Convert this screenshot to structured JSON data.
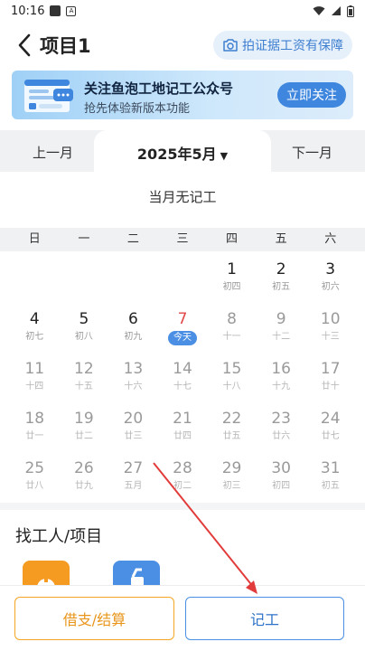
{
  "status_bar": {
    "time": "10:16"
  },
  "header": {
    "title": "项目1",
    "proof_label": "拍证据工资有保障"
  },
  "banner": {
    "title": "关注鱼泡工地记工公众号",
    "subtitle": "抢先体验新版本功能",
    "follow_label": "立即关注"
  },
  "month_nav": {
    "prev_label": "上一月",
    "current": "2025年5月",
    "next_label": "下一月"
  },
  "no_record_text": "当月无记工",
  "weekdays": [
    "日",
    "一",
    "二",
    "三",
    "四",
    "五",
    "六"
  ],
  "calendar": {
    "leading_blanks": 4,
    "days": [
      {
        "num": "1",
        "sub": "初四",
        "state": "past"
      },
      {
        "num": "2",
        "sub": "初五",
        "state": "past"
      },
      {
        "num": "3",
        "sub": "初六",
        "state": "past"
      },
      {
        "num": "4",
        "sub": "初七",
        "state": "past"
      },
      {
        "num": "5",
        "sub": "初八",
        "state": "past"
      },
      {
        "num": "6",
        "sub": "初九",
        "state": "past"
      },
      {
        "num": "7",
        "sub": "今天",
        "state": "today"
      },
      {
        "num": "8",
        "sub": "十一",
        "state": "future"
      },
      {
        "num": "9",
        "sub": "十二",
        "state": "future"
      },
      {
        "num": "10",
        "sub": "十三",
        "state": "future"
      },
      {
        "num": "11",
        "sub": "十四",
        "state": "future"
      },
      {
        "num": "12",
        "sub": "十五",
        "state": "future"
      },
      {
        "num": "13",
        "sub": "十六",
        "state": "future"
      },
      {
        "num": "14",
        "sub": "十七",
        "state": "future"
      },
      {
        "num": "15",
        "sub": "十八",
        "state": "future"
      },
      {
        "num": "16",
        "sub": "十九",
        "state": "future"
      },
      {
        "num": "17",
        "sub": "廿十",
        "state": "future"
      },
      {
        "num": "18",
        "sub": "廿一",
        "state": "future"
      },
      {
        "num": "19",
        "sub": "廿二",
        "state": "future"
      },
      {
        "num": "20",
        "sub": "廿三",
        "state": "future"
      },
      {
        "num": "21",
        "sub": "廿四",
        "state": "future"
      },
      {
        "num": "22",
        "sub": "廿五",
        "state": "future"
      },
      {
        "num": "23",
        "sub": "廿六",
        "state": "future"
      },
      {
        "num": "24",
        "sub": "廿七",
        "state": "future"
      },
      {
        "num": "25",
        "sub": "廿八",
        "state": "future"
      },
      {
        "num": "26",
        "sub": "廿九",
        "state": "future"
      },
      {
        "num": "27",
        "sub": "五月",
        "state": "future"
      },
      {
        "num": "28",
        "sub": "初二",
        "state": "future"
      },
      {
        "num": "29",
        "sub": "初三",
        "state": "future"
      },
      {
        "num": "30",
        "sub": "初四",
        "state": "future"
      },
      {
        "num": "31",
        "sub": "初五",
        "state": "future"
      }
    ]
  },
  "find_section": {
    "title": "找工人/项目"
  },
  "bottom_bar": {
    "borrow_label": "借支/结算",
    "record_label": "记工"
  },
  "colors": {
    "accent_blue": "#4a8fe4",
    "accent_orange": "#f5a623",
    "today_red": "#e04848",
    "annotation_arrow": "#e23b3b"
  },
  "icons": {
    "back": "chevron-left-icon",
    "camera": "camera-icon",
    "dropdown": "caret-down-icon",
    "wifi": "wifi-icon",
    "signal": "signal-icon",
    "battery": "battery-icon"
  }
}
